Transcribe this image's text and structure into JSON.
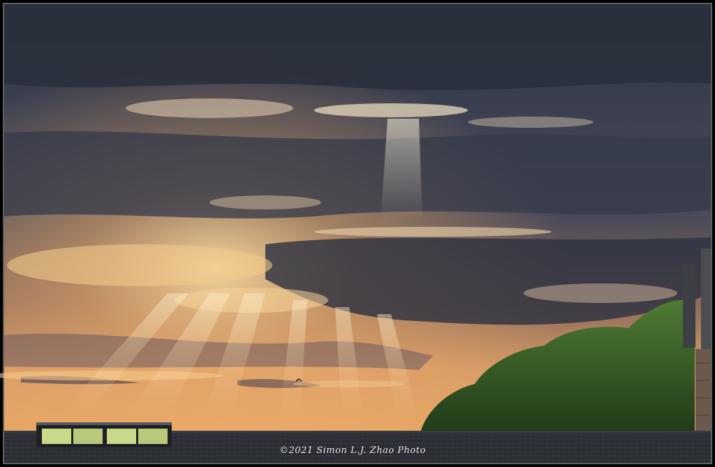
{
  "photo": {
    "subject": "sunset-crepuscular-rays",
    "colors": {
      "sky_dark": "#2c3140",
      "sky_mid": "#4a4f60",
      "cloud_highlight": "#f7d9a6",
      "horizon_glow": "#e29a58",
      "tree_green": "#3d6a2a",
      "roof": "#2a2d33",
      "window_glow": "#c9d98a"
    }
  },
  "watermark": {
    "text": "©2021  Simon  L.J.  Zhao  Photo"
  }
}
